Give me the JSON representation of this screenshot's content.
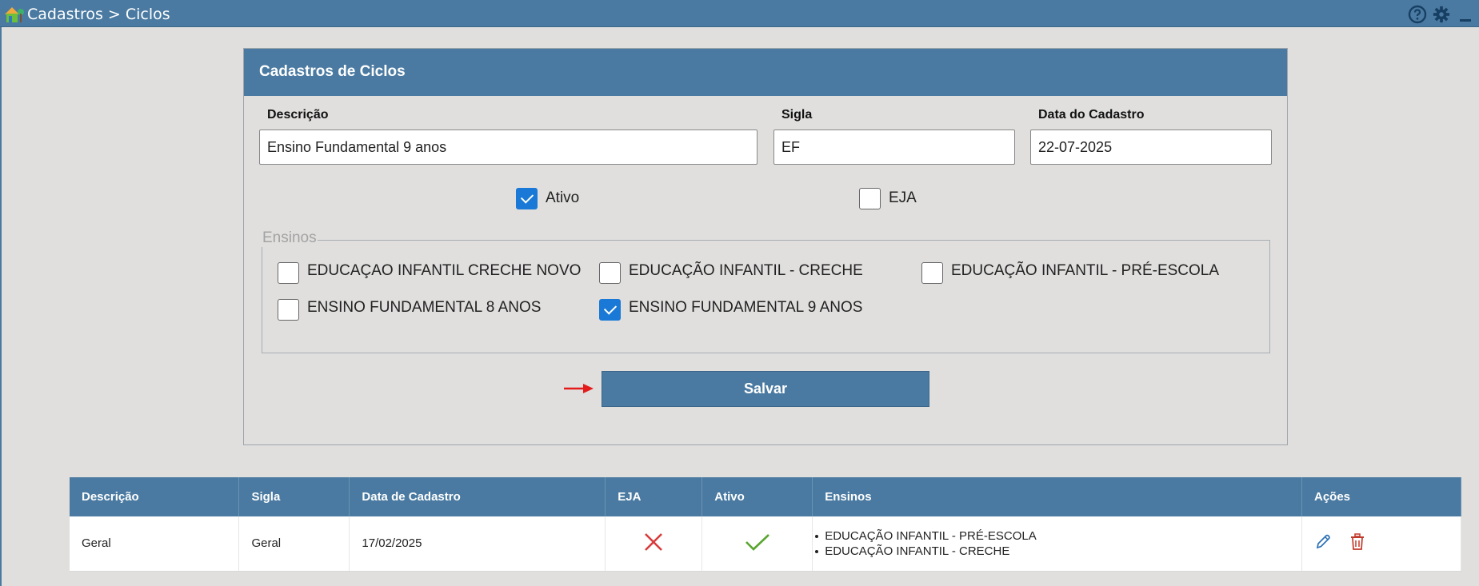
{
  "topbar": {
    "breadcrumb": "Cadastros > Ciclos"
  },
  "form": {
    "title": "Cadastros de Ciclos",
    "descricao": {
      "label": "Descrição",
      "value": "Ensino Fundamental 9 anos"
    },
    "sigla": {
      "label": "Sigla",
      "value": "EF"
    },
    "data_cadastro": {
      "label": "Data do Cadastro",
      "value": "22-07-2025"
    },
    "ativo": {
      "label": "Ativo",
      "checked": true
    },
    "eja": {
      "label": "EJA",
      "checked": false
    },
    "ensinos": {
      "legend": "Ensinos",
      "items": [
        {
          "label": "EDUCAÇAO INFANTIL CRECHE NOVO",
          "checked": false
        },
        {
          "label": "EDUCAÇÃO INFANTIL - CRECHE",
          "checked": false
        },
        {
          "label": "EDUCAÇÃO INFANTIL - PRÉ-ESCOLA",
          "checked": false
        },
        {
          "label": "ENSINO FUNDAMENTAL 8 ANOS",
          "checked": false
        },
        {
          "label": "ENSINO FUNDAMENTAL 9 ANOS",
          "checked": true
        }
      ]
    },
    "save_label": "Salvar"
  },
  "table": {
    "headers": [
      "Descrição",
      "Sigla",
      "Data de Cadastro",
      "EJA",
      "Ativo",
      "Ensinos",
      "Ações"
    ],
    "rows": [
      {
        "descricao": "Geral",
        "sigla": "Geral",
        "data": "17/02/2025",
        "eja": false,
        "ativo": true,
        "ensinos": [
          "EDUCAÇÃO INFANTIL - PRÉ-ESCOLA",
          "EDUCAÇÃO INFANTIL - CRECHE"
        ]
      }
    ]
  },
  "colors": {
    "header_bg": "#4a7aa1",
    "page_bg": "#e0dfde",
    "checkbox_checked": "#1a79d6",
    "no_icon": "#d83b3b",
    "yes_icon": "#5aa630",
    "delete_icon": "#c0392b",
    "edit_icon": "#2a6fb5",
    "arrow": "#e31b1b"
  },
  "icons": [
    "app-logo-icon",
    "help-icon",
    "gear-icon",
    "minimize-icon",
    "red-arrow-icon",
    "cross-icon",
    "check-icon",
    "edit-icon",
    "trash-icon"
  ]
}
